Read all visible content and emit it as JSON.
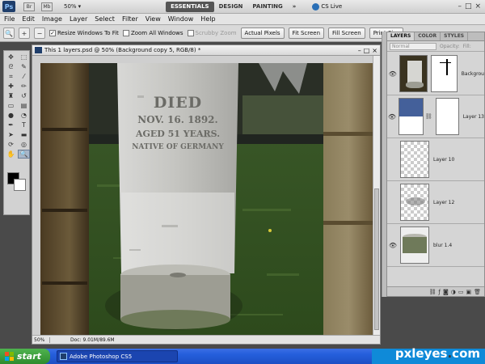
{
  "app": {
    "logo_text": "Ps",
    "mini_br": "Br",
    "mini_mb": "Mb",
    "zoom_level": "50%",
    "workspaces": [
      "ESSENTIALS",
      "DESIGN",
      "PAINTING"
    ],
    "more": "»",
    "cs_live": "CS Live",
    "win_buttons": [
      "–",
      "□",
      "×"
    ]
  },
  "menu": [
    "File",
    "Edit",
    "Image",
    "Layer",
    "Select",
    "Filter",
    "View",
    "Window",
    "Help"
  ],
  "options": {
    "resize_windows_label": "Resize Windows To Fit",
    "resize_windows_checked": true,
    "zoom_all_label": "Zoom All Windows",
    "scrubby_label": "Scrubby Zoom",
    "actual_pixels": "Actual Pixels",
    "fit_screen": "Fit Screen",
    "fill_screen": "Fill Screen",
    "print_size": "Print Size"
  },
  "document": {
    "title": "This 1 layers.psd @ 50% (Background copy 5, RGB/8) *",
    "status_zoom": "50%",
    "status_doc": "Doc: 9.01M/89.6M",
    "stone_text": [
      "DIED",
      "NOV. 16. 1892.",
      "AGED 51 YEARS.",
      "NATIVE OF GERMANY"
    ]
  },
  "panel": {
    "tabs": [
      "LAYERS",
      "COLOR",
      "STYLES"
    ],
    "blend_mode": "Normal",
    "opacity_label": "Opacity:",
    "fill_label": "Fill:",
    "layers": [
      {
        "name": "Backgrou",
        "visible": true,
        "thumb": "image"
      },
      {
        "name": "Layer 13",
        "visible": true,
        "thumb": "blue"
      },
      {
        "name": "Layer 10",
        "visible": false,
        "thumb": "checker"
      },
      {
        "name": "Layer 12",
        "visible": false,
        "thumb": "blur"
      },
      {
        "name": "blur 1.4",
        "visible": true,
        "thumb": "base"
      }
    ]
  },
  "taskbar": {
    "start": "start",
    "task_label": "Adobe Photoshop CS5"
  },
  "watermark": {
    "text_a": "pxleyes",
    "dot": ".",
    "text_b": "com"
  }
}
